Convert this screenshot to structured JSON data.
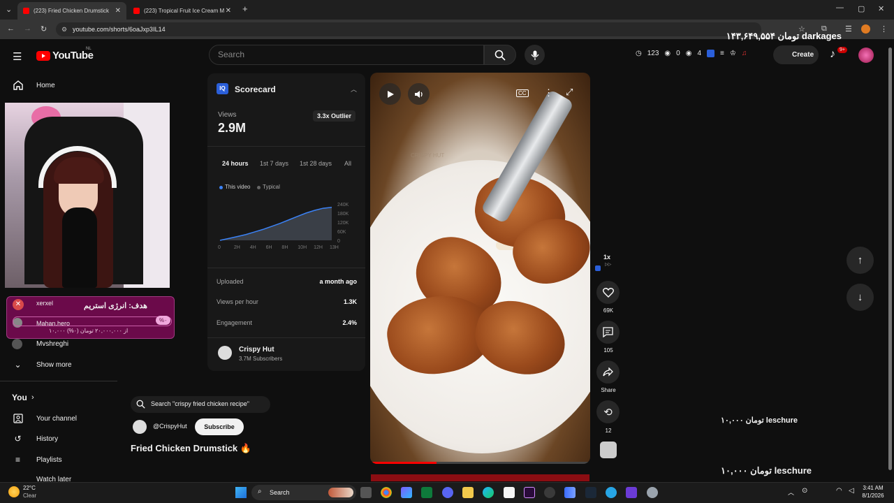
{
  "browser": {
    "tabs": [
      {
        "title": "(223) Fried Chicken Drumstick"
      },
      {
        "title": "(223) Tropical Fruit Ice Cream M"
      }
    ],
    "new_tab": "+",
    "url": "youtube.com/shorts/6oaJxp3IL14"
  },
  "youtube": {
    "logo_text": "YouTube",
    "region": "NL",
    "search_placeholder": "Search",
    "stats": {
      "a": "123",
      "b": "0",
      "c": "4"
    },
    "create_label": "Create",
    "notif_badge": "9+"
  },
  "overlay": {
    "toman_top": "۱۴۳,۶۴۹,۵۵۴ تومان darkages",
    "toman_mid": "۱۰,۰۰۰ تومان leschure",
    "toman_bottom": "۱۰,۰۰۰ تومان leschure",
    "donation_user1": "xerxel",
    "donation_title": "هدف: انرژی استریم",
    "donation_user2": "Mahan.hero",
    "donation_progress": "۱۰,۰۰۰ از ۲۰,۰۰۰,۰۰۰ تومان (۰%)",
    "donation_percent": "%۰"
  },
  "sidebar": {
    "home": "Home",
    "sub_user": "Mvshreghi",
    "show_more": "Show more",
    "you_header": "You",
    "your_channel": "Your channel",
    "history": "History",
    "playlists": "Playlists",
    "watch_later": "Watch later"
  },
  "scorecard": {
    "title": "Scorecard",
    "views_label": "Views",
    "views_value": "2.9M",
    "outlier": "3.3x Outlier",
    "ranges": [
      "24 hours",
      "1st 7 days",
      "1st 28 days",
      "All"
    ],
    "legend_this": "This video",
    "legend_typical": "Typical",
    "y_ticks": [
      "240K",
      "180K",
      "120K",
      "60K",
      "0"
    ],
    "x_ticks": [
      "0",
      "2H",
      "4H",
      "6H",
      "8H",
      "10H",
      "12H",
      "13H"
    ],
    "uploaded_label": "Uploaded",
    "uploaded_value": "a month ago",
    "vph_label": "Views per hour",
    "vph_value": "1.3K",
    "engagement_label": "Engagement",
    "engagement_value": "2.4%",
    "channel_name": "Crispy Hut",
    "channel_subs": "3.7M Subscribers"
  },
  "chart_data": {
    "type": "area",
    "x": [
      0,
      1,
      2,
      3,
      4,
      5,
      6,
      7,
      8,
      9,
      10,
      11,
      12,
      13
    ],
    "series": [
      {
        "name": "This video",
        "values": [
          0,
          12000,
          25000,
          38000,
          55000,
          72000,
          92000,
          112000,
          135000,
          158000,
          180000,
          198000,
          212000,
          218000
        ]
      }
    ],
    "ylim": [
      0,
      240000
    ],
    "colors": {
      "this": "#3b82f6",
      "typical": "#3a3f47"
    }
  },
  "video": {
    "search_suggestion": "Search \"crispy fried chicken recipe\"",
    "channel_handle": "@CrispyHut",
    "subscribe": "Subscribe",
    "title": "Fried Chicken Drumstick 🔥",
    "speed": "1x",
    "likes": "69K",
    "comments": "105",
    "share": "Share",
    "remix": "12",
    "watermark": "CRISPY HUT"
  },
  "taskbar": {
    "weather_temp": "22°C",
    "weather_desc": "Clear",
    "search": "Search",
    "time": "3:41 AM",
    "date": "8/1/2026"
  }
}
